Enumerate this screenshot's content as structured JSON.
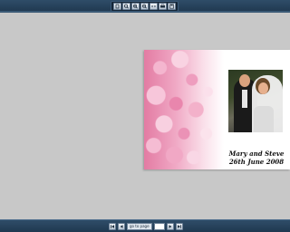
{
  "toolbar": {
    "buttons": [
      {
        "name": "single-page-icon"
      },
      {
        "name": "magnifier-icon"
      },
      {
        "name": "zoom-in-icon"
      },
      {
        "name": "zoom-out-icon"
      },
      {
        "name": "fit-width-icon"
      },
      {
        "name": "print-icon"
      },
      {
        "name": "save-icon"
      }
    ]
  },
  "document": {
    "caption_line1": "Mary and Steve",
    "caption_line2": "26th June 2008"
  },
  "navigation": {
    "page_label": "go to page",
    "page_value": ""
  },
  "colors": {
    "toolbar": "#2f4d68",
    "viewport": "#c8c8c8",
    "accent_pink": "#e986ad"
  }
}
